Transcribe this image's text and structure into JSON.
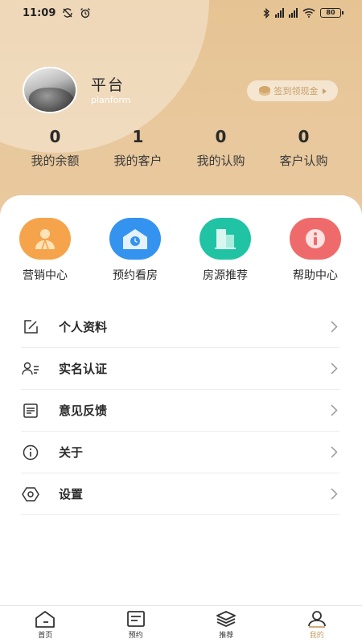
{
  "status_bar": {
    "time": "11:09",
    "battery": "80"
  },
  "profile": {
    "name": "平台",
    "subtitle": "planform",
    "signin_button": "签到领现金"
  },
  "stats": [
    {
      "value": "0",
      "label": "我的余额"
    },
    {
      "value": "1",
      "label": "我的客户"
    },
    {
      "value": "0",
      "label": "我的认购"
    },
    {
      "value": "0",
      "label": "客户认购"
    }
  ],
  "quick_actions": [
    {
      "label": "营销中心",
      "icon": "marketing-icon",
      "color": "#f6a44c"
    },
    {
      "label": "预约看房",
      "icon": "appointment-house-icon",
      "color": "#3393ef"
    },
    {
      "label": "房源推荐",
      "icon": "building-icon",
      "color": "#21c3a5"
    },
    {
      "label": "帮助中心",
      "icon": "help-info-icon",
      "color": "#ef6b6b"
    }
  ],
  "menu": [
    {
      "label": "个人资料",
      "icon": "edit-icon"
    },
    {
      "label": "实名认证",
      "icon": "id-verify-icon"
    },
    {
      "label": "意见反馈",
      "icon": "feedback-icon"
    },
    {
      "label": "关于",
      "icon": "info-icon"
    },
    {
      "label": "设置",
      "icon": "settings-icon"
    }
  ],
  "tabbar": [
    {
      "label": "首页",
      "icon": "home-icon",
      "active": false
    },
    {
      "label": "预约",
      "icon": "calendar-note-icon",
      "active": false
    },
    {
      "label": "推荐",
      "icon": "layers-icon",
      "active": false
    },
    {
      "label": "我的",
      "icon": "user-icon",
      "active": true
    }
  ],
  "colors": {
    "header_gold": "#e6c393",
    "accent": "#c9a06a"
  }
}
